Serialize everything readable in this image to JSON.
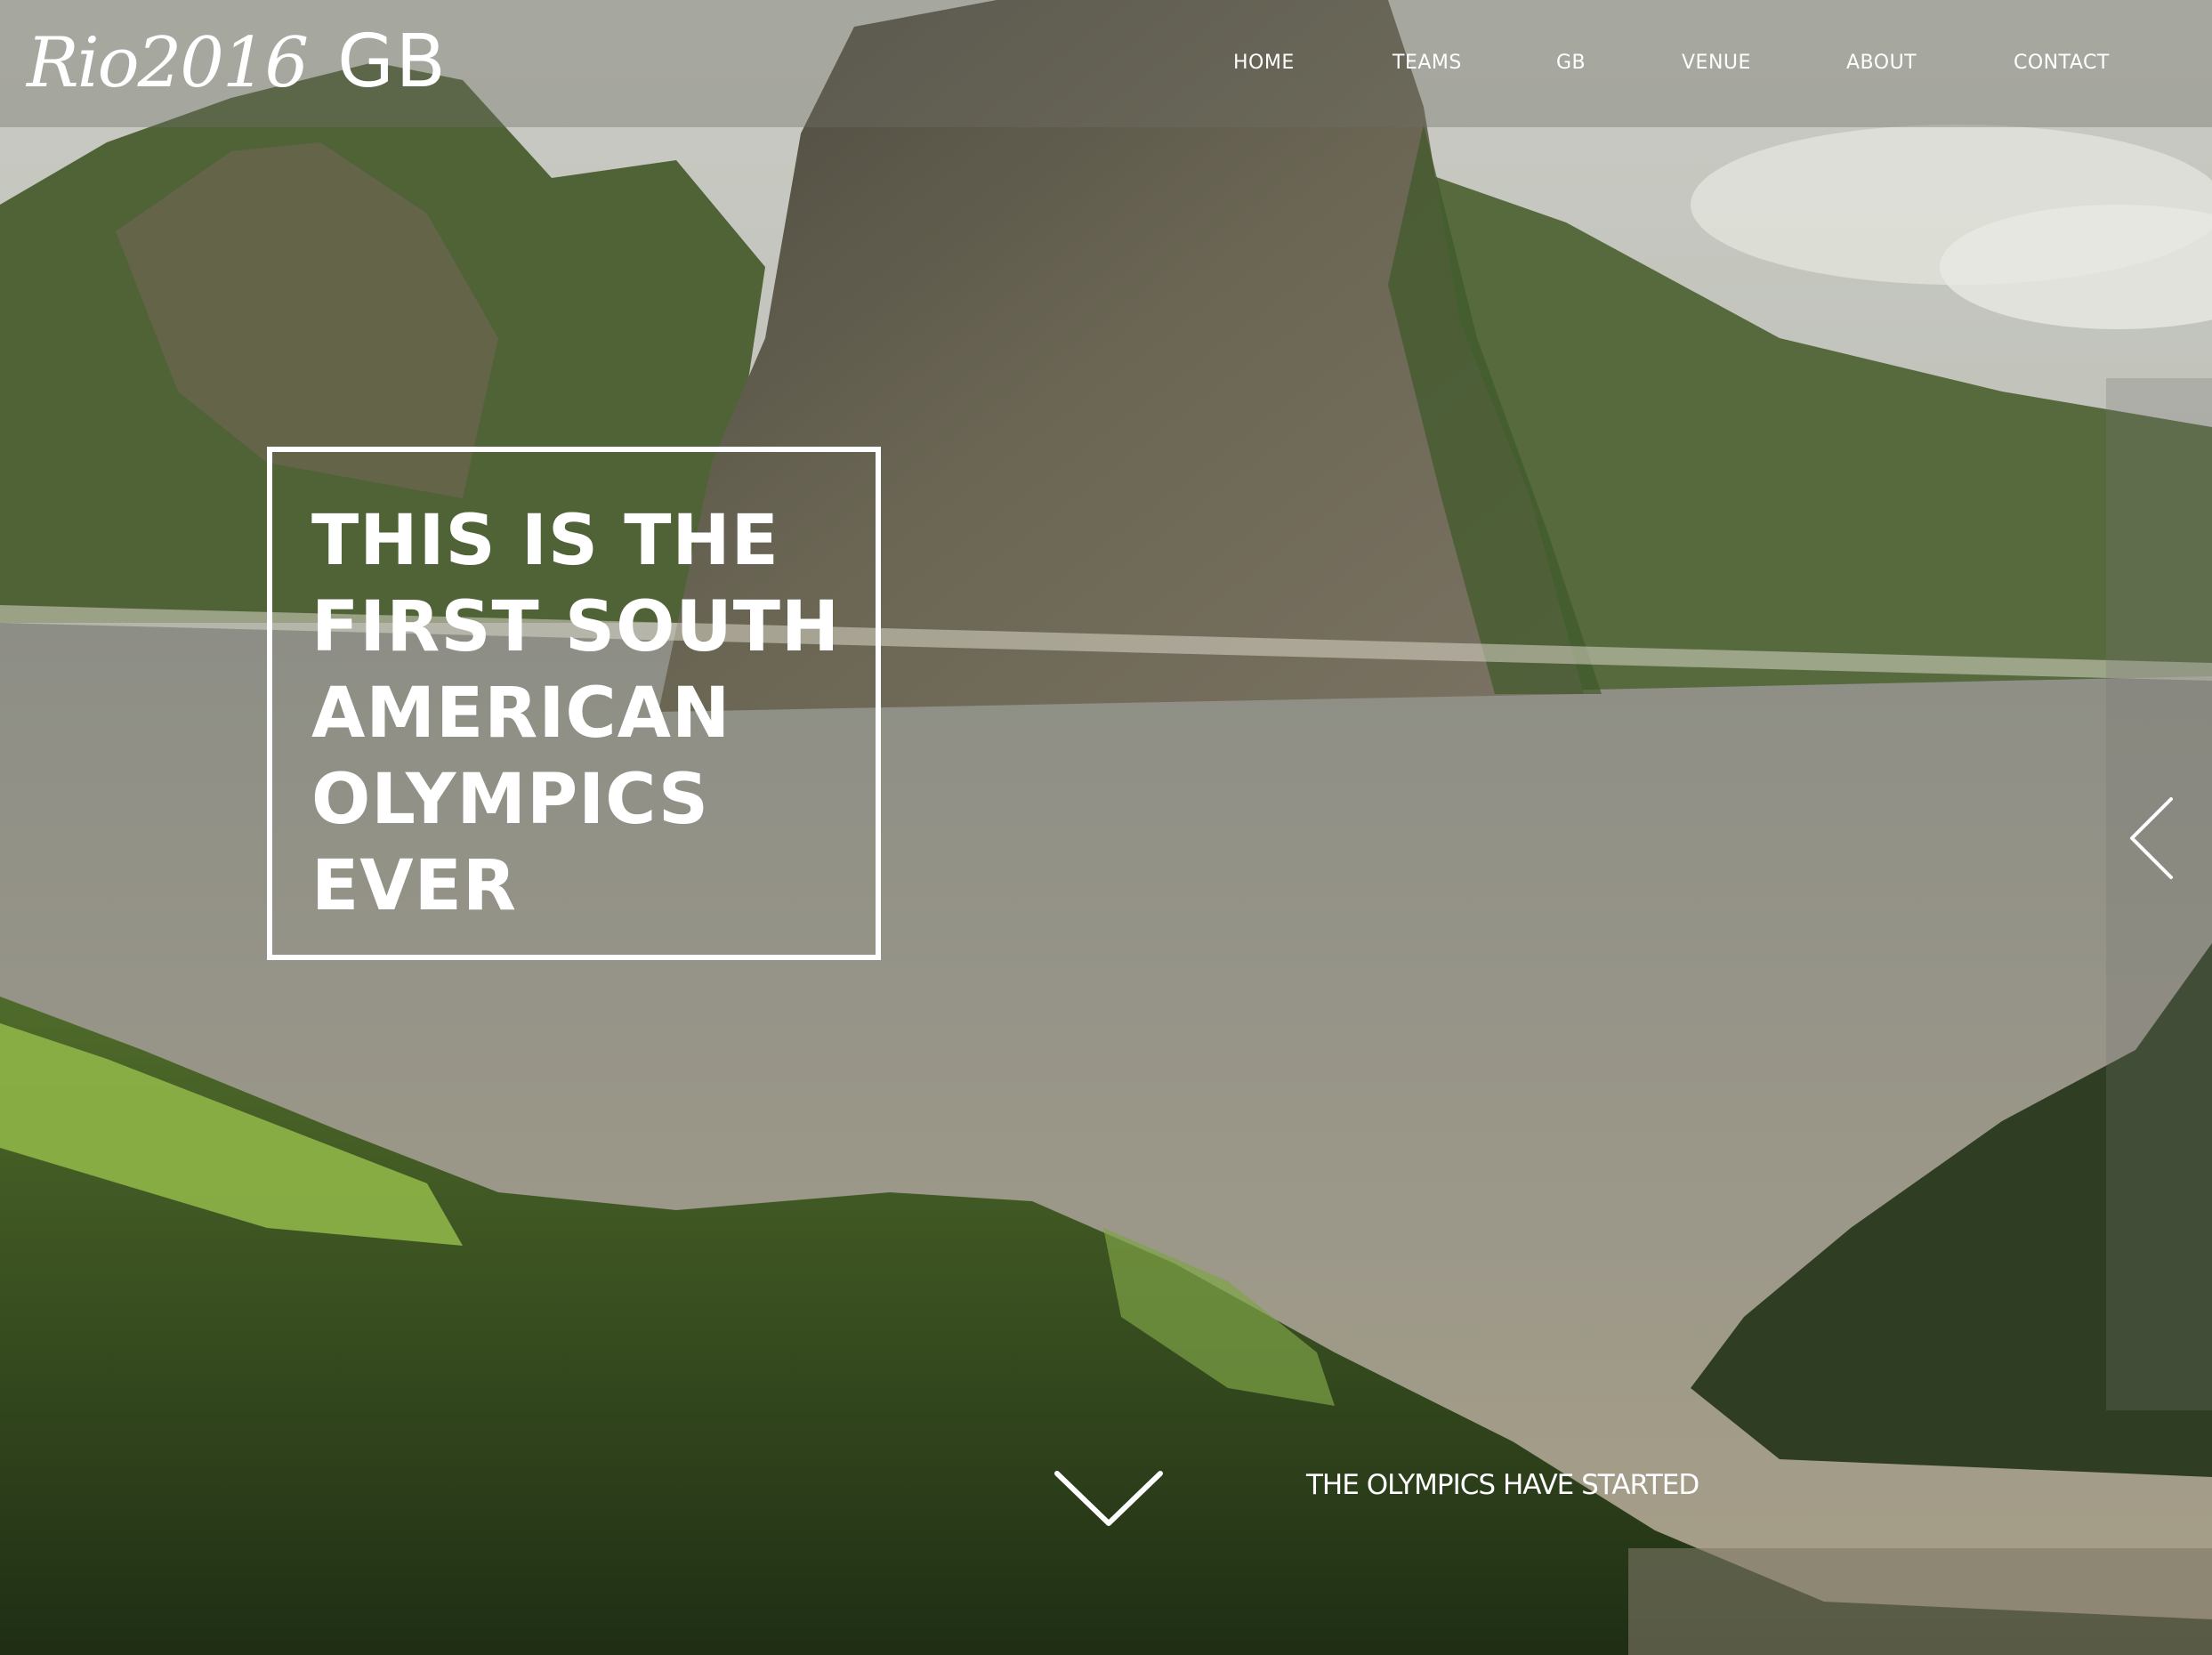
{
  "brand": {
    "script": "Rio2016",
    "suffix": "GB"
  },
  "nav": {
    "items": [
      {
        "id": "home",
        "label": "HOME"
      },
      {
        "id": "teams",
        "label": "TEAMS"
      },
      {
        "id": "gb",
        "label": "GB"
      },
      {
        "id": "venue",
        "label": "VENUE"
      },
      {
        "id": "about",
        "label": "ABOUT"
      },
      {
        "id": "contact",
        "label": "CONTACT"
      }
    ]
  },
  "hero": {
    "headline_lines": [
      "THIS IS THE",
      "FIRST SOUTH",
      "AMERICAN",
      "OLYMPICS",
      "EVER"
    ],
    "tagline": "THE OLYMPICS HAVE STARTED",
    "prev_icon": "chevron-left-icon",
    "scroll_icon": "chevron-down-icon"
  },
  "colors": {
    "text": "#ffffff",
    "overlay": "#6e6e64"
  }
}
